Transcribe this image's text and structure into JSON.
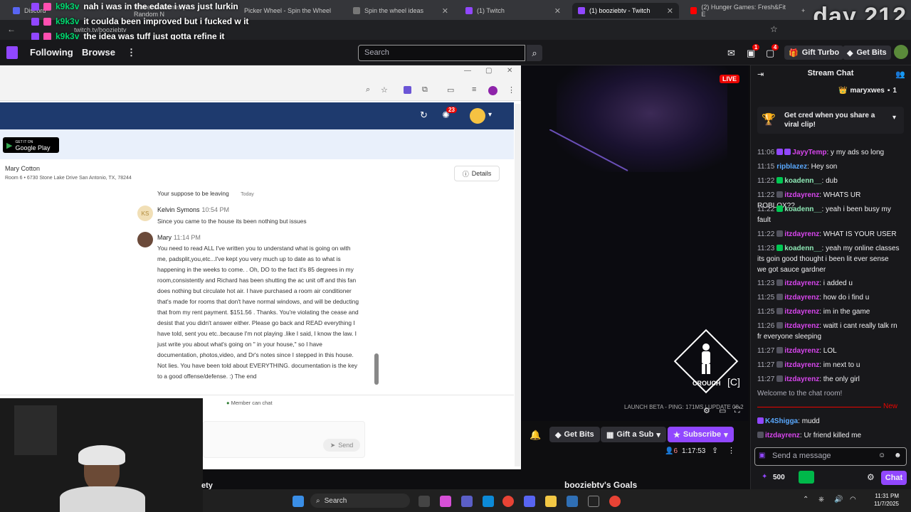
{
  "overlay": {
    "day_counter": "day 212",
    "messages": [
      {
        "user": "k9k3v",
        "text": "nah i was in the edate i was just lurkin"
      },
      {
        "user": "k9k3v",
        "text": "it coulda been improved but i fucked w it"
      },
      {
        "user": "k9k3v",
        "text": "the idea was tuff just gotta refine it"
      }
    ]
  },
  "browser": {
    "tabs": [
      {
        "label": "Discord"
      },
      {
        "label": "Wheel of Names | Random N"
      },
      {
        "label": "Picker Wheel - Spin the Wheel"
      },
      {
        "label": "Spin the wheel ideas"
      },
      {
        "label": "(1) Twitch"
      },
      {
        "label": "(1) booziebtv - Twitch"
      },
      {
        "label": "(2) Hunger Games: Fresh&Fit E"
      }
    ],
    "url": "twitch.tv/booziebtv"
  },
  "twitch_nav": {
    "following": "Following",
    "browse": "Browse",
    "search_placeholder": "Search",
    "notif_counts": [
      "1",
      "4"
    ],
    "gift_turbo": "Gift Turbo",
    "get_bits": "Get Bits"
  },
  "messaging_app": {
    "notif_count": "23",
    "google_play": "Google Play",
    "google_play_small": "GET IT ON",
    "contact_name": "Mary Cotton",
    "contact_address": "Room 6 • 6730 Stone Lake Drive San Antonio, TX, 78244",
    "details_label": "Details",
    "messages": [
      {
        "author": "",
        "time": "Today",
        "body": "Your suppose to be leaving"
      },
      {
        "author": "Kelvin Symons",
        "initials": "KS",
        "time": "10:54 PM",
        "body": "Since you came to the house its been nothing but issues"
      },
      {
        "author": "Mary",
        "time": "11:14 PM",
        "body": "You need to read ALL I've written you to understand what is going on with me, padsplit,you,etc...I've kept you very much up to date as to what is happening in the weeks to come. . Oh, DO to the fact it's 85 degrees in my room,consistently and Richard has been shutting the ac unit off and this fan does nothing but circulate hot air. I have purchased a room air conditioner that's made for rooms that don't have normal windows, and will be deducting that from my rent payment. $151.56 . Thanks. You're violating the cease and desist that you didn't answer either. Please go back and READ everything I have told, sent you etc..because I'm not playing .like I said, I know the law. I just write you about what's going on \" in your house,\" so I have documentation, photos,video, and Dr's notes since I stepped in this house. Not lies. You have been told about EVERYTHING. documentation is the key to a good offense/defense. :) The end"
      }
    ],
    "member_can_chat": "Member can chat",
    "send_label": "Send"
  },
  "stream": {
    "live_label": "LIVE",
    "crouch_label": "CROUCH",
    "crouch_key": "[C]",
    "ping_text": "LAUNCH BETA - PING: 171MS | UPDATE 08.2",
    "get_bits": "Get Bits",
    "gift_a_sub": "Gift a Sub",
    "subscribe": "Subscribe",
    "viewers": "6",
    "uptime": "1:17:53",
    "goals_title": "booziebtv's Goals",
    "channel_partial": "ety"
  },
  "chat": {
    "title": "Stream Chat",
    "top_user": "maryxwes",
    "top_count": "1",
    "clip_card": "Get cred when you share a viral clip!",
    "messages": [
      {
        "time": "11:06",
        "user": "JayyTemp",
        "color": "pink",
        "text": "y my ads so long"
      },
      {
        "time": "11:15",
        "user": "ripblazez",
        "color": "blue",
        "text": "Hey son"
      },
      {
        "time": "11:22",
        "user": "koadenn__",
        "color": "green",
        "text": "dub"
      },
      {
        "time": "11:22",
        "user": "itzdayrenz",
        "color": "pink",
        "text": "WHATS UR ROBLOX??"
      },
      {
        "time": "11:22",
        "user": "koadenn__",
        "color": "green",
        "text": "yeah i been busy my fault"
      },
      {
        "time": "11:22",
        "user": "itzdayrenz",
        "color": "pink",
        "text": "WHAT IS YOUR USER"
      },
      {
        "time": "11:23",
        "user": "koadenn__",
        "color": "green",
        "text": "yeah my online classes its goin good thought i been lit ever sense we got sauce gardner"
      },
      {
        "time": "11:23",
        "user": "itzdayrenz",
        "color": "pink",
        "text": "i added u"
      },
      {
        "time": "11:25",
        "user": "itzdayrenz",
        "color": "pink",
        "text": "how do i find u"
      },
      {
        "time": "11:25",
        "user": "itzdayrenz",
        "color": "pink",
        "text": "im in the game"
      },
      {
        "time": "11:26",
        "user": "itzdayrenz",
        "color": "pink",
        "text": "waitt i cant really talk rn fr everyone sleeping"
      },
      {
        "time": "11:27",
        "user": "itzdayrenz",
        "color": "pink",
        "text": "LOL"
      },
      {
        "time": "11:27",
        "user": "itzdayrenz",
        "color": "pink",
        "text": "im next to u"
      },
      {
        "time": "11:27",
        "user": "itzdayrenz",
        "color": "pink",
        "text": "the only girl"
      }
    ],
    "welcome": "Welcome to the chat room!",
    "new_label": "New",
    "after_new": [
      {
        "user": "K4Shigga",
        "color": "blue",
        "text": "mudd"
      },
      {
        "user": "itzdayrenz",
        "color": "pink",
        "text": "Ur friend killed me"
      }
    ],
    "input_placeholder": "Send a message",
    "points": "500",
    "chat_button": "Chat"
  },
  "taskbar": {
    "search_label": "Search",
    "time": "11:31 PM",
    "date": "11/7/2025"
  },
  "colors": {
    "twitch_purple": "#9147ff",
    "live_red": "#eb0400",
    "overlay_user_green": "#00d96f"
  }
}
